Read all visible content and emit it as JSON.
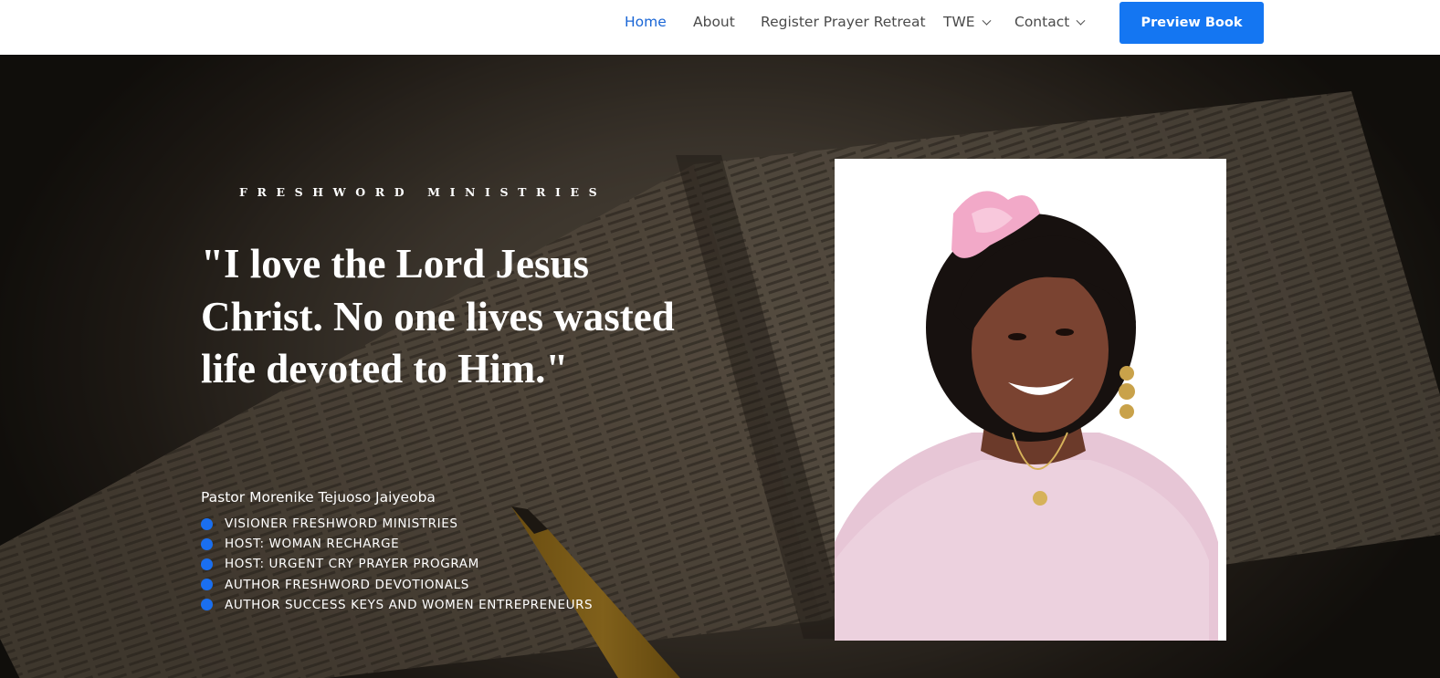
{
  "nav": {
    "items": [
      {
        "label": "Home",
        "active": true,
        "dropdown": false
      },
      {
        "label": "About",
        "active": false,
        "dropdown": false
      },
      {
        "label": "Register Prayer Retreat",
        "active": false,
        "dropdown": false
      },
      {
        "label": "TWE",
        "active": false,
        "dropdown": true
      },
      {
        "label": "Contact",
        "active": false,
        "dropdown": true
      }
    ],
    "cta_label": "Preview Book"
  },
  "hero": {
    "eyebrow": "FRESHWORD MINISTRIES",
    "quote": "\"I love the Lord Jesus Christ. No one lives wasted life devoted to Him.\"",
    "author": "Pastor Morenike Tejuoso Jaiyeoba",
    "roles": [
      "VISIONER FRESHWORD MINISTRIES",
      "HOST: WOMAN RECHARGE",
      "HOST: URGENT CRY PRAYER PROGRAM",
      "AUTHOR FRESHWORD DEVOTIONALS",
      "AUTHOR SUCCESS KEYS AND WOMEN ENTREPRENEURS"
    ],
    "background_image": "open-bible-with-pencil",
    "portrait_image": "smiling-woman-in-pink-lace-with-pink-headpiece"
  },
  "colors": {
    "accent": "#1476f2",
    "nav_active": "#1a66d6",
    "nav_text": "#4a4a4a",
    "bullet": "#1a6ff0",
    "hero_text": "#ffffff"
  }
}
